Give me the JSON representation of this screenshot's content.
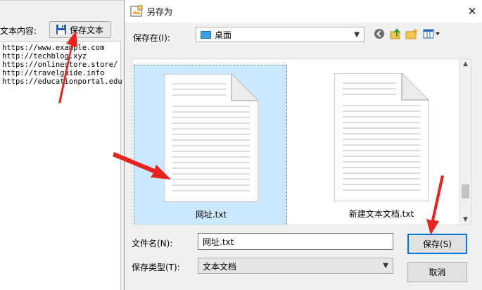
{
  "background_app": {
    "label": "文本内容:",
    "save_button_label": "保存文本",
    "urls": [
      "https://www.example.com",
      "http://techblog.xyz",
      "https://onlinestore.store/",
      "http://travelguide.info",
      "https://educationportal.edu"
    ]
  },
  "dialog": {
    "title": "另存为",
    "close_glyph": "✕",
    "save_in_label": "保存在(I):",
    "location": "桌面",
    "files": [
      {
        "name": "网址.txt",
        "selected": true
      },
      {
        "name": "新建文本文档.txt",
        "selected": false
      }
    ],
    "filename_label": "文件名(N):",
    "filename_value": "网址.txt",
    "filetype_label": "保存类型(T):",
    "filetype_value": "文本文档",
    "save_button": "保存(S)",
    "cancel_button": "取消"
  },
  "icons": [
    "floppy-disk-icon",
    "save-dialog-icon",
    "close-icon",
    "desktop-icon",
    "back-icon",
    "up-folder-icon",
    "new-folder-icon",
    "view-menu-icon",
    "text-file-icon",
    "red-arrow-annotation"
  ],
  "colors": {
    "selection": "#cce8ff",
    "primary_border": "#0078d7",
    "annotation": "#e8231f"
  }
}
